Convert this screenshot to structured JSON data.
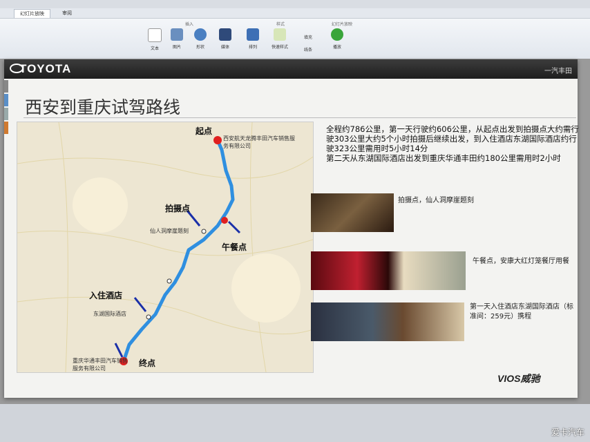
{
  "ribbon": {
    "tabs": [
      "幻灯片放映",
      "审阅"
    ],
    "groups": [
      "插入",
      "样式",
      "幻灯片放映"
    ],
    "buttons": [
      "文本",
      "图片",
      "形状",
      "媒体",
      "排列",
      "快速样式",
      "播放"
    ],
    "small_buttons": [
      "填充",
      "线条"
    ]
  },
  "slide": {
    "logo": "TOYOTA",
    "brand_right": "一汽丰田",
    "title": "西安到重庆试驾路线",
    "description": "全程约786公里，第一天行驶约606公里，从起点出发到拍摄点大约需行驶303公里大约5个小时拍摄后继续出发，到入住酒店东湖国际酒店约行驶323公里需用时5小时14分\n第二天从东湖国际酒店出发到重庆华通丰田约180公里需用时2小时",
    "map_labels": {
      "start": "起点",
      "start_place": "西安航天龙腾丰田汽车销售服务有限公司",
      "photo_spot": "拍摄点",
      "photo_place": "仙人洞摩崖题刻",
      "lunch": "午餐点",
      "hotel": "入住酒店",
      "hotel_place": "东湖国际酒店",
      "end": "终点",
      "end_place": "重庆华通丰田汽车销售服务有限公司"
    },
    "captions": {
      "photo": "拍摄点，仙人洞摩崖题刻",
      "lunch": "午餐点，安康大红灯笼餐厅用餐",
      "hotel": "第一天入住酒店东湖国际酒店（标准间：259元）携程"
    },
    "footer_logo": "VIOS威驰"
  },
  "watermark": "爱卡汽车",
  "colors": {
    "route": "#2f8fe0",
    "arrow": "#1a2fa8",
    "pin": "#e02020"
  }
}
